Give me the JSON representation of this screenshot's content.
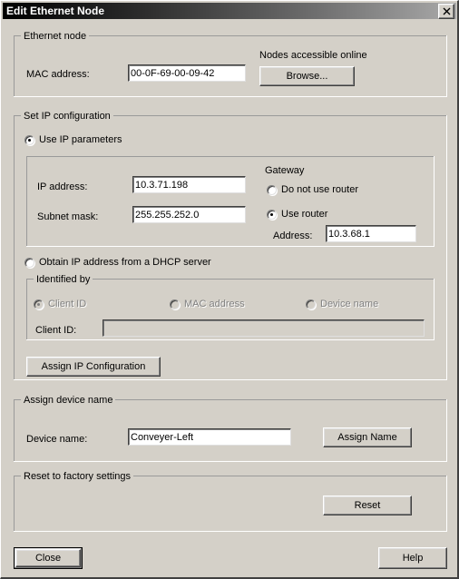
{
  "window": {
    "title": "Edit Ethernet Node",
    "close_label": "✕"
  },
  "ethernet_node": {
    "group_title": "Ethernet node",
    "mac_label": "MAC address:",
    "mac_value": "00-0F-69-00-09-42",
    "nodes_online_label": "Nodes accessible online",
    "browse_label": "Browse..."
  },
  "ip_config": {
    "group_title": "Set IP configuration",
    "use_ip_parameters_label": "Use IP parameters",
    "use_ip_parameters_checked": true,
    "ip_label": "IP address:",
    "ip_value": "10.3.71.198",
    "subnet_label": "Subnet mask:",
    "subnet_value": "255.255.252.0",
    "gateway_title": "Gateway",
    "do_not_use_router_label": "Do not use router",
    "do_not_use_router_checked": false,
    "use_router_label": "Use router",
    "use_router_checked": true,
    "router_address_label": "Address:",
    "router_address_value": "10.3.68.1",
    "dhcp_label": "Obtain IP address from a DHCP server",
    "dhcp_checked": false,
    "identified_by": {
      "group_title": "Identified by",
      "client_id_radio_label": "Client ID",
      "client_id_radio_checked": true,
      "mac_address_radio_label": "MAC address",
      "mac_address_radio_checked": false,
      "device_name_radio_label": "Device name",
      "device_name_radio_checked": false,
      "client_id_label": "Client ID:",
      "client_id_value": ""
    },
    "assign_ip_button": "Assign IP Configuration"
  },
  "device_name": {
    "group_title": "Assign device name",
    "label": "Device name:",
    "value": "Conveyer-Left",
    "assign_button": "Assign Name"
  },
  "factory_reset": {
    "group_title": "Reset to factory settings",
    "reset_button": "Reset"
  },
  "footer": {
    "close_button": "Close",
    "help_button": "Help"
  },
  "colors": {
    "dialog_face": "#d4d0c8",
    "field_background": "#ffffff",
    "disabled_text": "#808080",
    "title_gradient_start": "#000000",
    "title_gradient_end": "#a9a9a9"
  }
}
